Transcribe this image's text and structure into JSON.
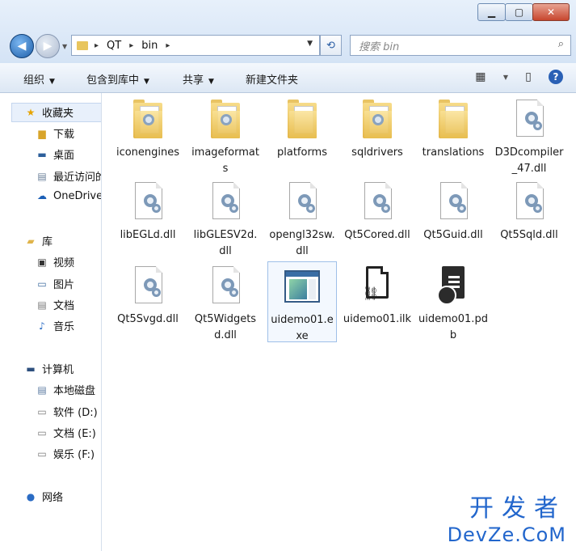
{
  "window": {
    "controls": {
      "minimize": "▁",
      "maximize": "▢",
      "close": "✕"
    }
  },
  "address": {
    "crumbs": [
      "QT",
      "bin"
    ],
    "separator": "▸"
  },
  "search": {
    "placeholder": "搜索 bin"
  },
  "toolbar": {
    "organize": "组织",
    "include_in_library": "包含到库中",
    "share": "共享",
    "new_folder": "新建文件夹",
    "caret": "▼"
  },
  "sidebar": {
    "favorites": "收藏夹",
    "downloads": "下载",
    "desktop": "桌面",
    "recent": "最近访问的位置",
    "onedrive": "OneDrive",
    "libraries": "库",
    "videos": "视频",
    "pictures": "图片",
    "documents": "文档",
    "music": "音乐",
    "computer": "计算机",
    "local_disk": "本地磁盘",
    "drive_d": "软件 (D:)",
    "drive_e": "文档 (E:)",
    "drive_f": "娱乐 (F:)",
    "network": "网络"
  },
  "files": [
    {
      "name": "iconengines",
      "type": "folder"
    },
    {
      "name": "imageformats",
      "type": "folder"
    },
    {
      "name": "platforms",
      "type": "folder"
    },
    {
      "name": "sqldrivers",
      "type": "folder"
    },
    {
      "name": "translations",
      "type": "folder"
    },
    {
      "name": "D3Dcompiler_47.dll",
      "type": "dll"
    },
    {
      "name": "libEGLd.dll",
      "type": "dll"
    },
    {
      "name": "libGLESV2d.dll",
      "type": "dll"
    },
    {
      "name": "opengl32sw.dll",
      "type": "dll"
    },
    {
      "name": "Qt5Cored.dll",
      "type": "dll"
    },
    {
      "name": "Qt5Guid.dll",
      "type": "dll"
    },
    {
      "name": "Qt5Sqld.dll",
      "type": "dll"
    },
    {
      "name": "Qt5Svgd.dll",
      "type": "dll"
    },
    {
      "name": "Qt5Widgetsd.dll",
      "type": "dll"
    },
    {
      "name": "uidemo01.exe",
      "type": "exe"
    },
    {
      "name": "uidemo01.ilk",
      "type": "ilk"
    },
    {
      "name": "uidemo01.pdb",
      "type": "pdb"
    }
  ],
  "watermark": {
    "cn": "开发者",
    "en": "DevZe.CoM"
  }
}
